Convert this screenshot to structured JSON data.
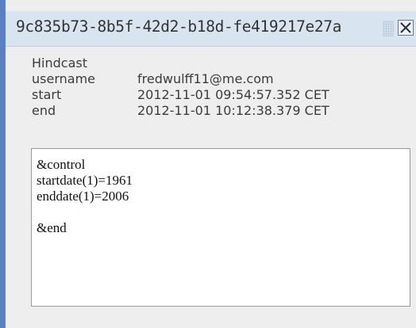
{
  "window": {
    "title": "9c835b73-8b5f-42d2-b18d-fe419217e27a",
    "close_icon": "close-x-icon",
    "grip_icon": "drag-grip-icon"
  },
  "info": {
    "heading": "Hindcast",
    "rows": [
      {
        "key": "username",
        "value": "fredwulff11@me.com"
      },
      {
        "key": "start",
        "value": "2012-11-01 09:54:57.352 CET"
      },
      {
        "key": "end",
        "value": "2012-11-01 10:12:38.379 CET"
      }
    ]
  },
  "editor": {
    "lines": [
      "&control",
      "startdate(1)=1961",
      "enddate(1)=2006",
      "",
      "&end"
    ]
  },
  "colors": {
    "frame_accent": "#5a7fc4",
    "titlebar_bg": "#d9e4f1",
    "window_bg": "#eeeeee"
  }
}
